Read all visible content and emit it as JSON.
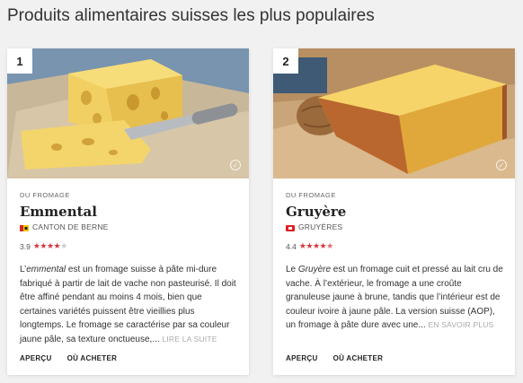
{
  "page": {
    "heading": "Produits alimentaires suisses les plus populaires"
  },
  "cards": [
    {
      "rank": "1",
      "category": "DU FROMAGE",
      "name": "Emmental",
      "origin": "CANTON DE BERNE",
      "rating": "3.9",
      "stars_filled": 4,
      "desc_lead": "L’",
      "desc_italic": "emmental",
      "desc_text": " est un fromage suisse à pâte mi-dure fabriqué à partir de lait de vache non pasteurisé. Il doit être affiné pendant au moins 4 mois, bien que certaines variétés puissent être vieillies plus longtemps. Le fromage se caractérise par sa couleur jaune pâle, sa texture onctueuse,... ",
      "more": "LIRE LA SUITE",
      "link1": "APERÇU",
      "link2": "OÙ ACHETER",
      "flag_color": "#d62b1e",
      "icon": "image-check-icon"
    },
    {
      "rank": "2",
      "category": "DU FROMAGE",
      "name": "Gruyère",
      "origin": "GRUYÈRES",
      "rating": "4.4",
      "stars_filled": 4.5,
      "desc_lead": "Le ",
      "desc_italic": "Gruyère",
      "desc_text": " est un fromage cuit et pressé au lait cru de vache. À l’extérieur, le fromage a une croûte granuleuse jaune à brune, tandis que l’intérieur est de couleur ivoire à jaune pâle. La version suisse (AOP), un fromage à pâte dure avec une... ",
      "more": "EN SAVOIR PLUS",
      "link1": "APERÇU",
      "link2": "OÙ ACHETER",
      "flag_color": "#e01f26",
      "icon": "image-check-icon"
    }
  ]
}
